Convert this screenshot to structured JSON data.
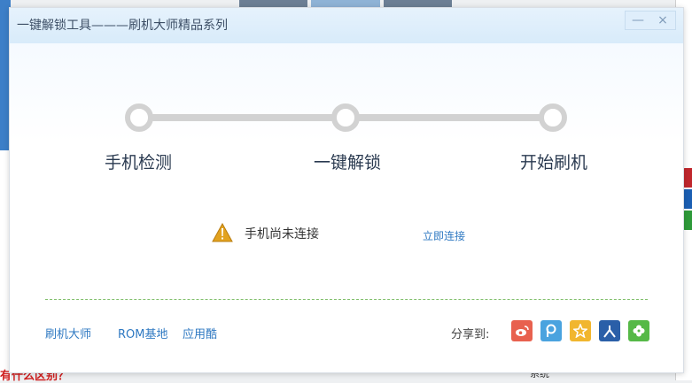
{
  "dialog": {
    "title": "一键解锁工具———刷机大师精品系列",
    "minimize_glyph": "—",
    "close_glyph": "×"
  },
  "steps": [
    {
      "label": "手机检测"
    },
    {
      "label": "一键解锁"
    },
    {
      "label": "开始刷机"
    }
  ],
  "status": {
    "message": "手机尚未连接",
    "connect_label": "立即连接",
    "icon": "warning-icon"
  },
  "footer": {
    "links": [
      "刷机大师",
      "ROM基地",
      "应用酷"
    ],
    "share_label": "分享到:",
    "share_targets": [
      {
        "icon": "weibo-icon",
        "color": "#e8614f"
      },
      {
        "icon": "tencent-weibo-icon",
        "color": "#4aa3df"
      },
      {
        "icon": "qzone-icon",
        "color": "#f1b62e"
      },
      {
        "icon": "renren-icon",
        "color": "#2a5fa8"
      },
      {
        "icon": "kaixin-icon",
        "color": "#55b947"
      }
    ]
  },
  "background": {
    "bottom_text": "有什么区别？",
    "bottom_right_text": "系统"
  },
  "colors": {
    "accent": "#2f79c2",
    "step_track": "#d2d2d2",
    "divider": "#7fbf6a",
    "warning": "#e2a21f"
  }
}
